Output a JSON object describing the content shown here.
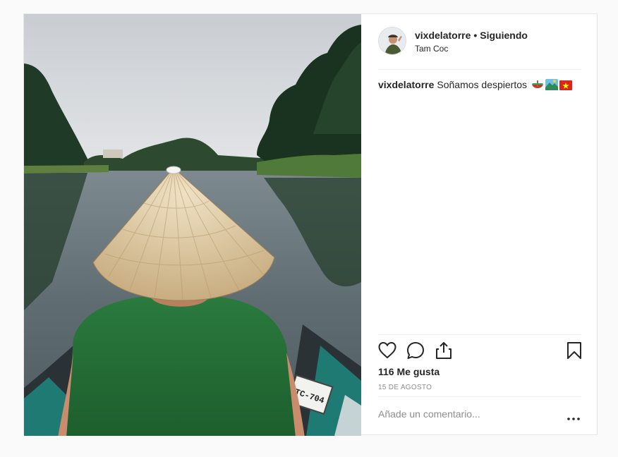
{
  "post": {
    "username": "vixdelatorre",
    "separator": "•",
    "follow_status": "Siguiendo",
    "location": "Tam Coc",
    "caption_user": "vixdelatorre",
    "caption_text": "Soñamos despiertos",
    "caption_emojis": [
      "canoe-emoji",
      "national-park-emoji",
      "vietnam-flag-emoji"
    ],
    "likes": "116 Me gusta",
    "date": "15 DE AGOSTO",
    "comment_placeholder": "Añade un comentario...",
    "boat_plate": "TC-704"
  },
  "icons": {
    "like": "heart-icon",
    "comment": "comment-bubble-icon",
    "share": "share-upload-icon",
    "save": "bookmark-icon",
    "more": "ellipsis-icon"
  },
  "colors": {
    "text": "#262626",
    "secondary": "#8e8e8e",
    "border": "#efefef",
    "background": "#fafafa"
  }
}
